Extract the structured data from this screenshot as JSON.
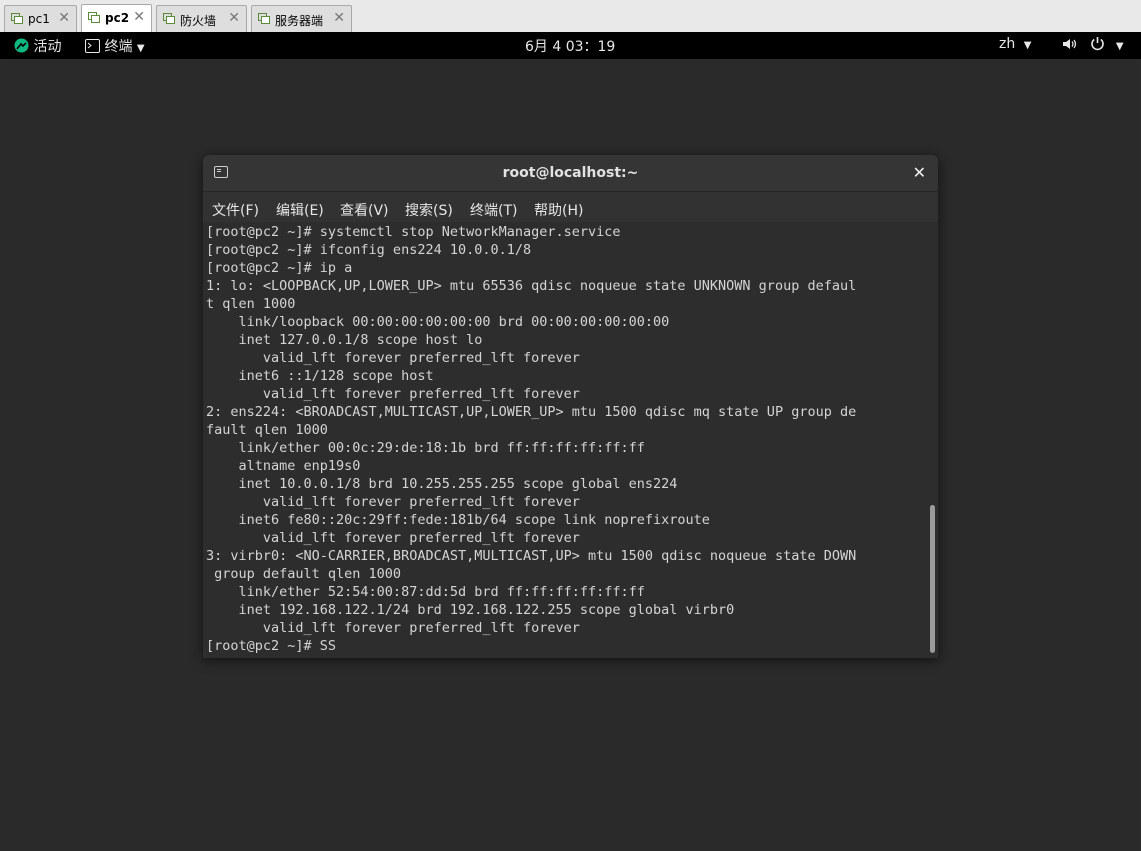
{
  "vm_tabs": [
    {
      "label": "pc1",
      "close": "✕"
    },
    {
      "label": "pc2",
      "close": "✕"
    },
    {
      "label": "防火墙",
      "close": "✕"
    },
    {
      "label": "服务器端",
      "close": "✕"
    }
  ],
  "topbar": {
    "activities": "活动",
    "app_menu": "终端",
    "clock": "6月 4 03：19",
    "input_method": "zh"
  },
  "terminal": {
    "title": "root@localhost:~",
    "close": "✕",
    "menu": [
      "文件(F)",
      "编辑(E)",
      "查看(V)",
      "搜索(S)",
      "终端(T)",
      "帮助(H)"
    ],
    "lines": [
      "[root@pc2 ~]# systemctl stop NetworkManager.service",
      "[root@pc2 ~]# ifconfig ens224 10.0.0.1/8",
      "[root@pc2 ~]# ip a",
      "1: lo: <LOOPBACK,UP,LOWER_UP> mtu 65536 qdisc noqueue state UNKNOWN group defaul",
      "t qlen 1000",
      "    link/loopback 00:00:00:00:00:00 brd 00:00:00:00:00:00",
      "    inet 127.0.0.1/8 scope host lo",
      "       valid_lft forever preferred_lft forever",
      "    inet6 ::1/128 scope host",
      "       valid_lft forever preferred_lft forever",
      "2: ens224: <BROADCAST,MULTICAST,UP,LOWER_UP> mtu 1500 qdisc mq state UP group de",
      "fault qlen 1000",
      "    link/ether 00:0c:29:de:18:1b brd ff:ff:ff:ff:ff:ff",
      "    altname enp19s0",
      "    inet 10.0.0.1/8 brd 10.255.255.255 scope global ens224",
      "       valid_lft forever preferred_lft forever",
      "    inet6 fe80::20c:29ff:fede:181b/64 scope link noprefixroute",
      "       valid_lft forever preferred_lft forever",
      "3: virbr0: <NO-CARRIER,BROADCAST,MULTICAST,UP> mtu 1500 qdisc noqueue state DOWN",
      " group default qlen 1000",
      "    link/ether 52:54:00:87:dd:5d brd ff:ff:ff:ff:ff:ff",
      "    inet 192.168.122.1/24 brd 192.168.122.255 scope global virbr0",
      "       valid_lft forever preferred_lft forever",
      "[root@pc2 ~]# SS"
    ]
  }
}
